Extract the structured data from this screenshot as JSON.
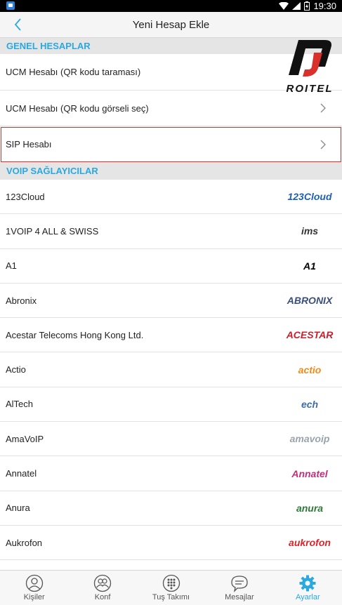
{
  "status_bar": {
    "time": "19:30"
  },
  "header": {
    "title": "Yeni Hesap Ekle"
  },
  "sections": {
    "general": "GENEL HESAPLAR",
    "voip": "VOIP SAĞLAYICILAR"
  },
  "general_accounts": [
    {
      "label": "UCM Hesabı (QR kodu taraması)"
    },
    {
      "label": "UCM Hesabı (QR kodu görseli seç)"
    },
    {
      "label": "SIP Hesabı"
    }
  ],
  "brand": {
    "name": "ROITEL",
    "color": "#111111"
  },
  "providers": [
    {
      "label": "123Cloud",
      "logo": "123Cloud",
      "color": "#1e5fb0"
    },
    {
      "label": "1VOIP 4 ALL & SWISS",
      "logo": "ims",
      "color": "#333333"
    },
    {
      "label": "A1",
      "logo": "A1",
      "color": "#000000"
    },
    {
      "label": "Abronix",
      "logo": "ABRONIX",
      "color": "#3a4f7a"
    },
    {
      "label": "Acestar Telecoms Hong Kong Ltd.",
      "logo": "ACESTAR",
      "color": "#c8202f"
    },
    {
      "label": "Actio",
      "logo": "actio",
      "color": "#f28a1a"
    },
    {
      "label": "AlTech",
      "logo": "ech",
      "color": "#3b6ea8"
    },
    {
      "label": "AmaVoIP",
      "logo": "amavoip",
      "color": "#9aa3ad"
    },
    {
      "label": "Annatel",
      "logo": "Annatel",
      "color": "#c0307a"
    },
    {
      "label": "Anura",
      "logo": "anura",
      "color": "#2f7a3a"
    },
    {
      "label": "Aukrofon",
      "logo": "aukrofon",
      "color": "#d8232a"
    }
  ],
  "tabs": [
    {
      "label": "Kişiler",
      "icon": "contacts-icon"
    },
    {
      "label": "Konf",
      "icon": "conference-icon"
    },
    {
      "label": "Tuş Takımı",
      "icon": "dialpad-icon"
    },
    {
      "label": "Mesajlar",
      "icon": "messages-icon"
    },
    {
      "label": "Ayarlar",
      "icon": "settings-icon"
    }
  ],
  "colors": {
    "accent": "#2aa8e0",
    "highlight": "#d9302c"
  }
}
